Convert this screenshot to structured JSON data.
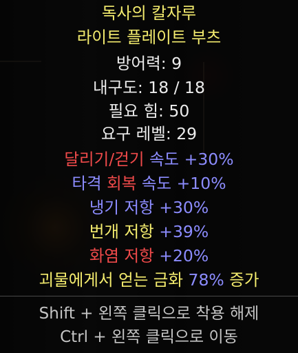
{
  "item": {
    "name": "독사의 칼자루",
    "base_type": "라이트 플레이트 부츠"
  },
  "base_stats": {
    "defense": "방어력: 9",
    "durability": "내구도: 18 / 18",
    "required_strength": "필요 힘: 50",
    "required_level": "요구 레벨: 29"
  },
  "magic_properties": {
    "run_walk_label": "달리기/걷기",
    "run_walk_value": "속도 +30%",
    "hit_recovery_prefix": "타격",
    "hit_recovery_label": "회복",
    "hit_recovery_value": "속도 +10%",
    "cold_resist_label": "냉기 저항",
    "cold_resist_value": "+30%",
    "lightning_resist_label": "번개 저항",
    "lightning_resist_value": "+39%",
    "fire_resist_label": "화염 저항",
    "fire_resist_value": "+20%",
    "gold_find_label": "괴물에게서 얻는 금화",
    "gold_find_value": "78%",
    "gold_find_suffix": "증가"
  },
  "hints": {
    "shift_click": "Shift + 왼쪽 클릭으로 착용 해제",
    "ctrl_click": "Ctrl + 왼쪽 클릭으로 이동"
  },
  "colors": {
    "unique_name": "#f4ec6e",
    "base_stat": "#ececec",
    "magic": "#8c8cff",
    "fire": "#f04a4a",
    "hint": "#c4c4c4"
  }
}
